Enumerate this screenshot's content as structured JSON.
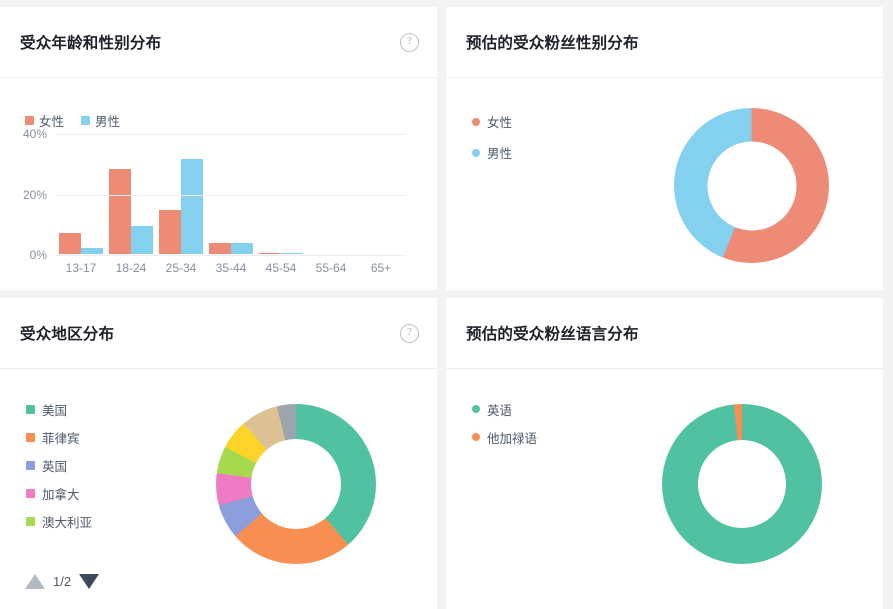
{
  "colors": {
    "female": "#ee8b77",
    "male": "#84d0ef",
    "green": "#51c2a1",
    "orange": "#f98e52",
    "periwinkle": "#8b9ddb",
    "pink": "#ef7bc4",
    "yellowgreen": "#a8d84d",
    "yellow": "#fbd329",
    "tan": "#dcc194",
    "gray": "#9aa5ae",
    "page_bg": "#f2f3f5",
    "card_bg": "#ffffff"
  },
  "cards": {
    "age_gender": {
      "title": "受众年龄和性别分布",
      "help_icon": "question-circle-icon"
    },
    "fan_gender": {
      "title": "预估的受众粉丝性别分布"
    },
    "region": {
      "title": "受众地区分布",
      "help_icon": "question-circle-icon",
      "pager": {
        "up_icon": "triangle-up-icon",
        "text": "1/2",
        "down_icon": "triangle-down-icon"
      }
    },
    "fan_language": {
      "title": "预估的受众粉丝语言分布"
    }
  },
  "chart_data": [
    {
      "id": "age-gender-bar",
      "type": "bar",
      "title": "受众年龄和性别分布",
      "xlabel": "",
      "ylabel": "",
      "ylim": [
        0,
        40
      ],
      "yticks": [
        "0%",
        "20%",
        "40%"
      ],
      "ytick_values": [
        0,
        20,
        40
      ],
      "grid": true,
      "legend_position": "top-left",
      "categories": [
        "13-17",
        "18-24",
        "25-34",
        "35-44",
        "45-54",
        "55-64",
        "65+"
      ],
      "series": [
        {
          "name": "女性",
          "color": "#ee8b77",
          "values": [
            6.8,
            28.1,
            14.6,
            3.5,
            0.4,
            0,
            0
          ]
        },
        {
          "name": "男性",
          "color": "#84d0ef",
          "values": [
            2.0,
            9.2,
            31.5,
            3.5,
            0.3,
            0,
            0
          ]
        }
      ]
    },
    {
      "id": "fan-gender-donut",
      "type": "pie",
      "title": "预估的受众粉丝性别分布",
      "legend_position": "left",
      "categories": [
        "女性",
        "男性"
      ],
      "values": [
        56,
        44
      ],
      "colors": [
        "#ee8b77",
        "#84d0ef"
      ]
    },
    {
      "id": "region-donut",
      "type": "pie",
      "title": "受众地区分布",
      "legend_position": "left",
      "categories": [
        "美国",
        "菲律宾",
        "英国",
        "加拿大",
        "澳大利亚",
        "",
        "",
        ""
      ],
      "legend_categories": [
        "美国",
        "菲律宾",
        "英国",
        "加拿大",
        "澳大利亚"
      ],
      "values": [
        39.5,
        25.0,
        7.0,
        6.5,
        5.5,
        6.0,
        7.5,
        3.0
      ],
      "colors": [
        "#51c2a1",
        "#f98e52",
        "#8b9ddb",
        "#ef7bc4",
        "#a8d84d",
        "#fbd329",
        "#dcc194",
        "#9aa5ae"
      ]
    },
    {
      "id": "fan-language-donut",
      "type": "pie",
      "title": "预估的受众粉丝语言分布",
      "legend_position": "left",
      "categories": [
        "英语",
        "他加禄语"
      ],
      "values": [
        98,
        2
      ],
      "colors": [
        "#51c2a1",
        "#f98e52"
      ]
    }
  ]
}
